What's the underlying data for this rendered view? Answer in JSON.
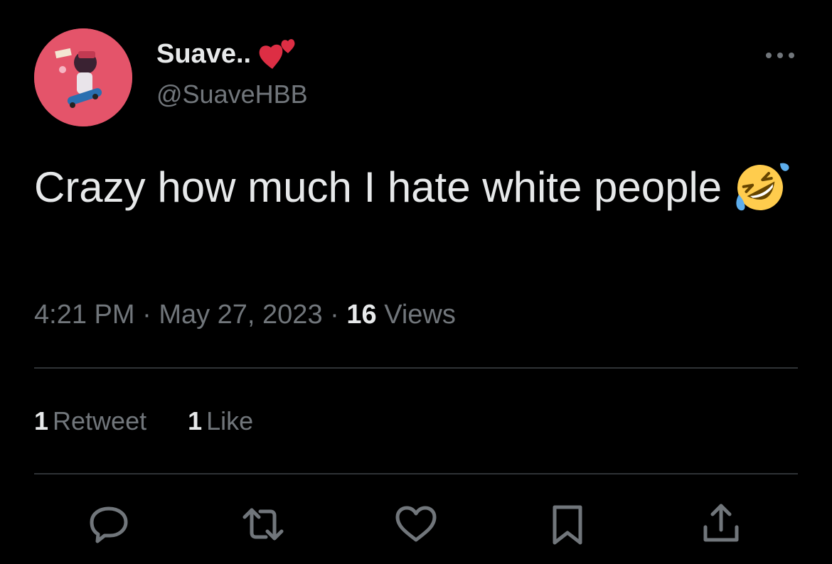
{
  "user": {
    "display_name": "Suave..",
    "handle": "@SuaveHBB",
    "name_emoji": "two-hearts-icon",
    "avatar_color": "#e4546a"
  },
  "tweet": {
    "text": "Crazy how much I hate white people",
    "emoji": "rolling-on-floor-laughing-icon"
  },
  "meta": {
    "time": "4:21 PM",
    "separator1": " · ",
    "date": "May 27, 2023",
    "separator2": " · ",
    "views_count": "16",
    "views_label": " Views"
  },
  "stats": {
    "retweets_count": "1",
    "retweets_label": "Retweet",
    "likes_count": "1",
    "likes_label": "Like"
  },
  "actions": [
    "reply-icon",
    "retweet-icon",
    "like-icon",
    "bookmark-icon",
    "share-icon"
  ],
  "colors": {
    "background": "#000000",
    "primary_text": "#e7e9ea",
    "secondary_text": "#71767b",
    "divider": "#2f3336",
    "heart_red": "#e0245e"
  }
}
